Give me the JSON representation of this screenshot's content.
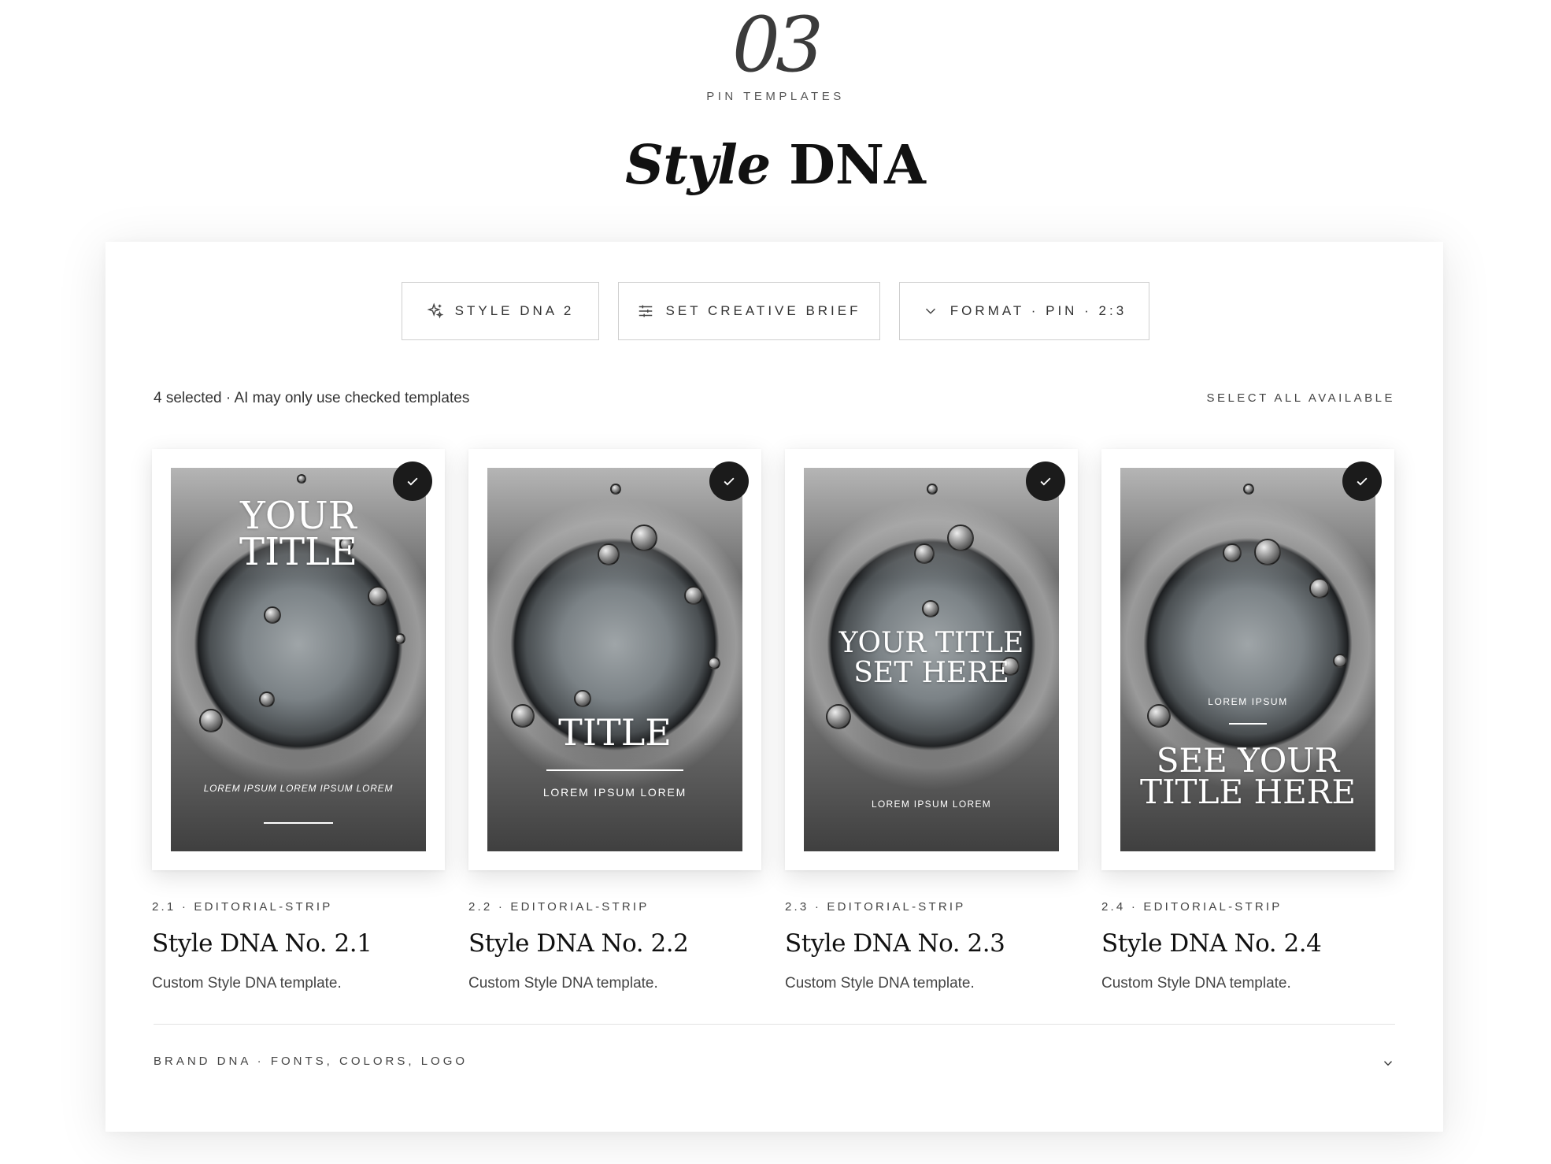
{
  "header": {
    "section_number": "03",
    "section_label": "PIN TEMPLATES",
    "title_italic": "Style",
    "title_rest": " DNA"
  },
  "toolbar": {
    "style_dna_label": "STYLE DNA 2",
    "creative_brief_label": "SET CREATIVE BRIEF",
    "format_label": "FORMAT · PIN · 2:3"
  },
  "selection": {
    "status_text": "4 selected · AI may only use checked templates",
    "select_all_label": "SELECT ALL AVAILABLE"
  },
  "templates": [
    {
      "meta": "2.1 · EDITORIAL-STRIP",
      "name": "Style DNA No. 2.1",
      "description": "Custom Style DNA template.",
      "checked": true,
      "preview_title_line1": "YOUR",
      "preview_title_line2": "TITLE",
      "preview_subtitle": "LOREM IPSUM LOREM IPSUM LOREM"
    },
    {
      "meta": "2.2 · EDITORIAL-STRIP",
      "name": "Style DNA No. 2.2",
      "description": "Custom Style DNA template.",
      "checked": true,
      "preview_title": "TITLE",
      "preview_subtitle": "LOREM IPSUM LOREM"
    },
    {
      "meta": "2.3 · EDITORIAL-STRIP",
      "name": "Style DNA No. 2.3",
      "description": "Custom Style DNA template.",
      "checked": true,
      "preview_title_line1": "YOUR TITLE",
      "preview_title_line2": "SET HERE",
      "preview_subtitle": "LOREM IPSUM LOREM"
    },
    {
      "meta": "2.4 · EDITORIAL-STRIP",
      "name": "Style DNA No. 2.4",
      "description": "Custom Style DNA template.",
      "checked": true,
      "preview_kicker": "LOREM IPSUM",
      "preview_title_line1": "SEE YOUR",
      "preview_title_line2": "TITLE HERE"
    }
  ],
  "brand_section": {
    "label": "BRAND DNA · FONTS, COLORS, LOGO"
  },
  "icons": {
    "style_dna": "sparkles-icon",
    "creative_brief": "sliders-icon",
    "format": "chevron-down-icon",
    "checkmark": "check-icon",
    "brand_toggle": "chevron-down-icon"
  },
  "colors": {
    "accent_dark": "#1b1b1b",
    "text_muted": "#444444",
    "border": "#cfcfcf"
  }
}
